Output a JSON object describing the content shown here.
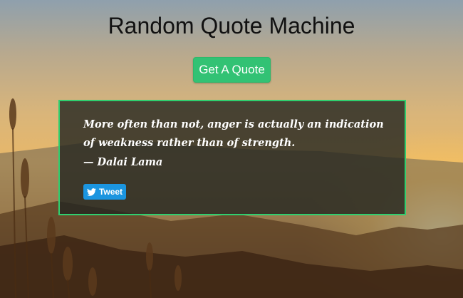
{
  "page": {
    "title": "Random Quote Machine"
  },
  "actions": {
    "get_quote_label": "Get A Quote",
    "tweet_label": "Tweet"
  },
  "quote": {
    "text": "More often than not, anger is actually an indication of weakness rather than of strength.",
    "author": "— Dalai Lama"
  },
  "icons": {
    "tweet_icon": "twitter-bird-icon"
  },
  "colors": {
    "accent_green": "#32c274",
    "box_border": "#2fcf6f",
    "tweet_blue": "#1b95e0"
  }
}
